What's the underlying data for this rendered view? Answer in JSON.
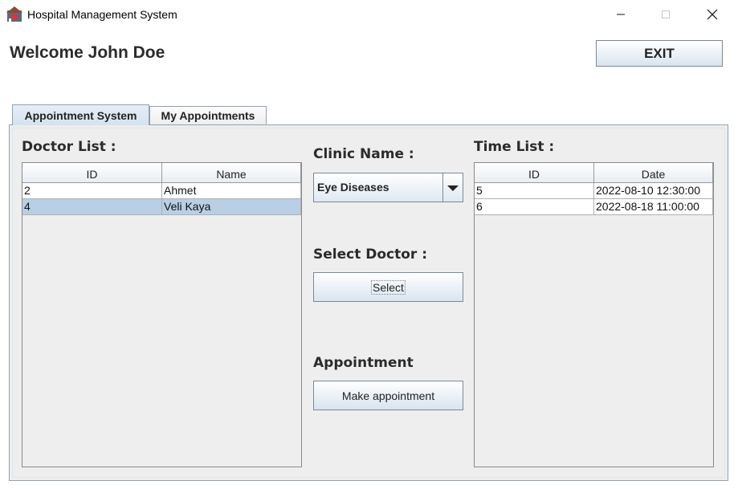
{
  "window": {
    "title": "Hospital Management System",
    "icon": "hospital-app-icon"
  },
  "header": {
    "welcome": "Welcome John Doe",
    "exit_label": "EXIT"
  },
  "tabs": [
    {
      "label": "Appointment System",
      "active": true
    },
    {
      "label": "My Appointments",
      "active": false
    }
  ],
  "doctor_list": {
    "label": "Doctor List :",
    "columns": [
      "ID",
      "Name"
    ],
    "rows": [
      {
        "id": "2",
        "name": "Ahmet",
        "selected": false
      },
      {
        "id": "4",
        "name": "Veli Kaya",
        "selected": true
      }
    ]
  },
  "clinic": {
    "label": "Clinic Name :",
    "selected": "Eye Diseases"
  },
  "select_doctor": {
    "label": "Select Doctor :",
    "button": "Select"
  },
  "appointment": {
    "label": "Appointment",
    "button": "Make appointment"
  },
  "time_list": {
    "label": "Time List :",
    "columns": [
      "ID",
      "Date"
    ],
    "rows": [
      {
        "id": "5",
        "date": "2022-08-10 12:30:00"
      },
      {
        "id": "6",
        "date": "2022-08-18 11:00:00"
      }
    ]
  },
  "colors": {
    "selection": "#b8cfe5",
    "tab_border": "#8fa2b4",
    "panel_bg": "#eeeeee"
  }
}
